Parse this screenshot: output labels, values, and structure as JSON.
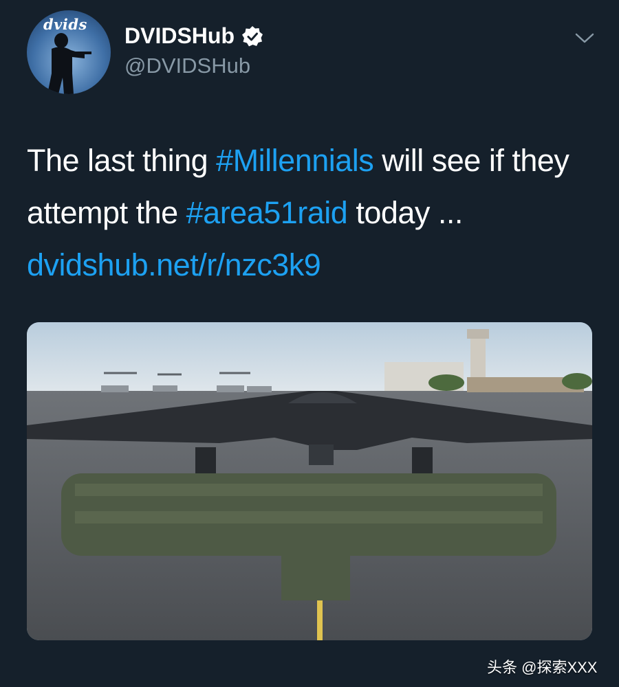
{
  "tweet": {
    "display_name": "DVIDSHub",
    "handle": "@DVIDSHub",
    "avatar_text": "dvids",
    "text_1": "The last thing ",
    "hashtag_1": "#Millennials",
    "text_2": " will see if they attempt the ",
    "hashtag_2": "#area51raid",
    "text_3": " today ...",
    "link": "dvidshub.net/r/nzc3k9"
  },
  "watermark": "头条 @探索XXX",
  "colors": {
    "background": "#15202b",
    "link": "#1da1f2",
    "secondary_text": "#8899a6"
  },
  "icons": [
    "verified-icon",
    "chevron-down-icon"
  ]
}
